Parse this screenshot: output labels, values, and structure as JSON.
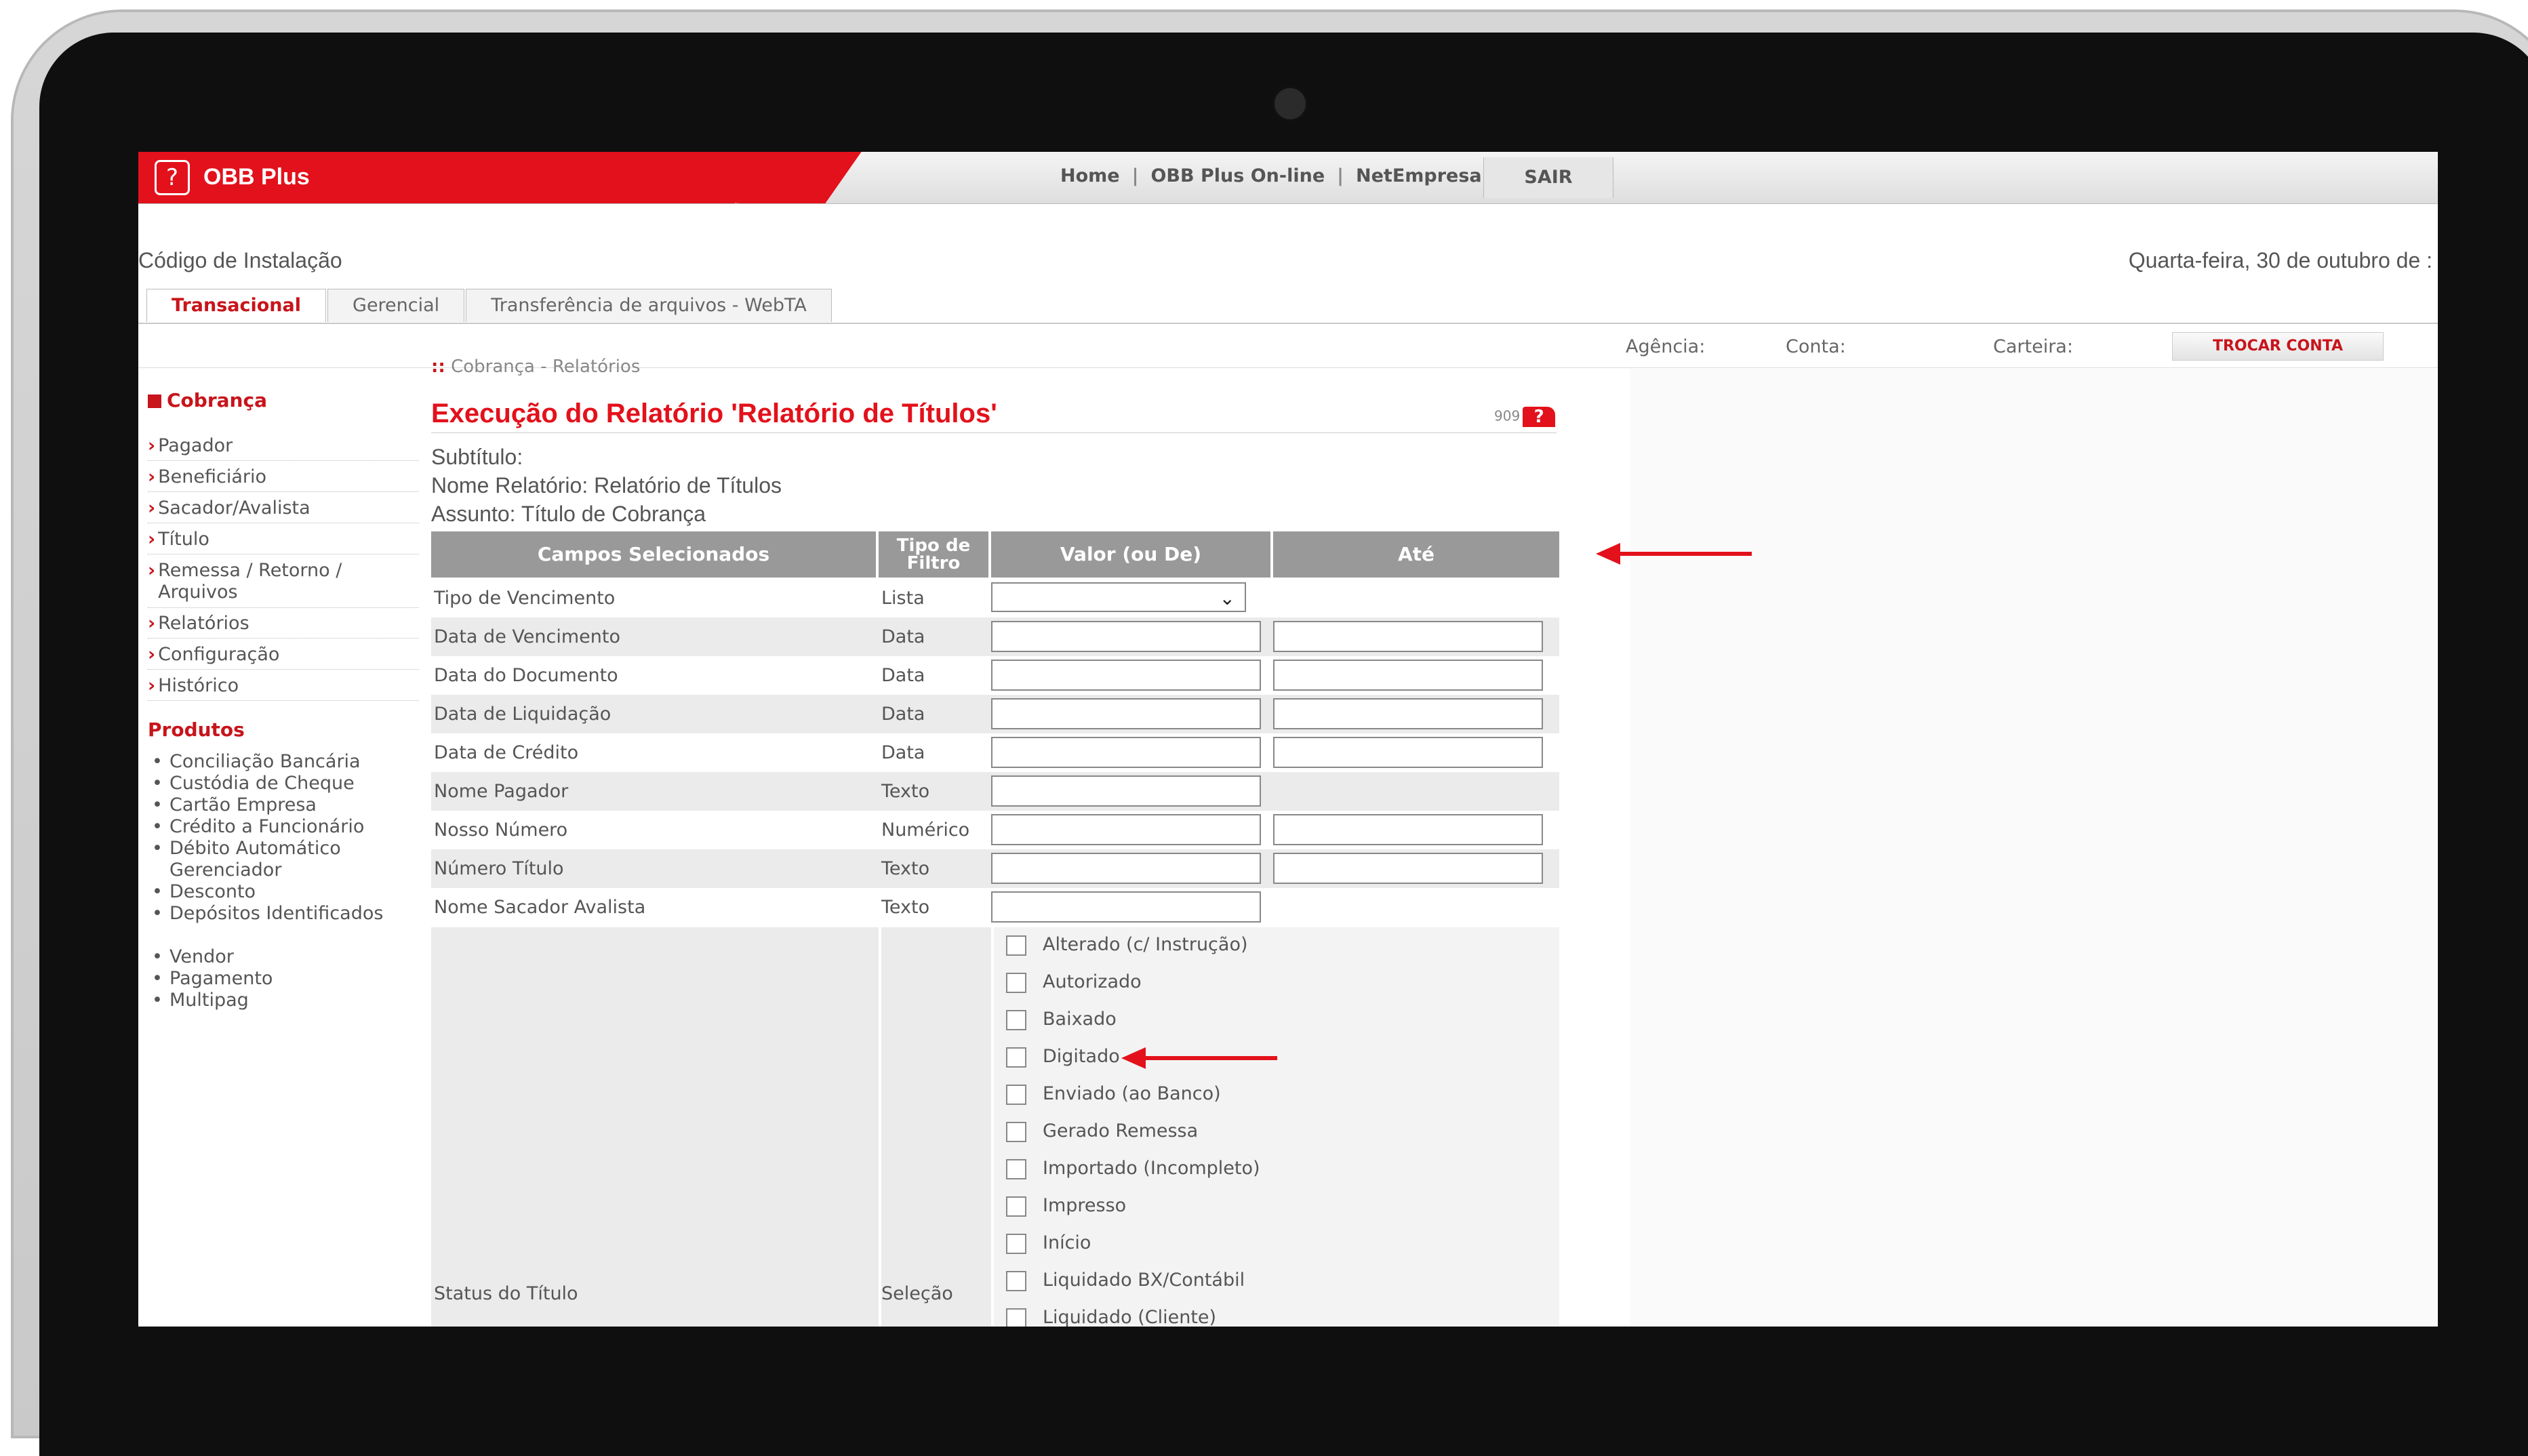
{
  "header": {
    "brand": "OBB Plus",
    "nav": [
      "Home",
      "OBB Plus On-line",
      "NetEmpresa"
    ],
    "logout": "SAIR",
    "install_code_label": "Código de Instalação",
    "date": "Quarta-feira, 30 de outubro de :"
  },
  "tabs": [
    "Transacional",
    "Gerencial",
    "Transferência de arquivos - WebTA"
  ],
  "account": {
    "agencia_label": "Agência:",
    "conta_label": "Conta:",
    "carteira_label": "Carteira:",
    "change_button": "TROCAR CONTA"
  },
  "sidebar": {
    "section_title": "Cobrança",
    "items": [
      "Pagador",
      "Beneficiário",
      "Sacador/Avalista",
      "Título",
      "Remessa / Retorno / Arquivos",
      "Relatórios",
      "Configuração",
      "Histórico"
    ],
    "products_title": "Produtos",
    "products": [
      "Conciliação Bancária",
      "Custódia de Cheque",
      "Cartão Empresa",
      "Crédito a Funcionário",
      "Débito Automático Gerenciador",
      "Desconto",
      "Depósitos Identificados",
      "Vendor",
      "Pagamento",
      "Multipag"
    ]
  },
  "main": {
    "breadcrumb": "Cobrança - Relatórios",
    "title": "Execução do Relatório 'Relatório de Títulos'",
    "help_code": "909",
    "subtitle_label": "Subtítulo:",
    "report_name": "Nome Relatório: Relatório de Títulos",
    "subject": "Assunto: Título de Cobrança"
  },
  "table": {
    "headers": [
      "Campos Selecionados",
      "Tipo de Filtro",
      "Valor (ou De)",
      "Até"
    ],
    "rows": [
      {
        "field": "Tipo de Vencimento",
        "type": "Lista"
      },
      {
        "field": "Data de Vencimento",
        "type": "Data"
      },
      {
        "field": "Data do Documento",
        "type": "Data"
      },
      {
        "field": "Data de Liquidação",
        "type": "Data"
      },
      {
        "field": "Data de Crédito",
        "type": "Data"
      },
      {
        "field": "Nome Pagador",
        "type": "Texto"
      },
      {
        "field": "Nosso Número",
        "type": "Numérico"
      },
      {
        "field": "Número Título",
        "type": "Texto"
      },
      {
        "field": "Nome Sacador Avalista",
        "type": "Texto"
      }
    ],
    "status": {
      "field": "Status do Título",
      "type": "Seleção",
      "options": [
        "Alterado (c/ Instrução)",
        "Autorizado",
        "Baixado",
        "Digitado",
        "Enviado (ao Banco)",
        "Gerado Remessa",
        "Importado (Incompleto)",
        "Impresso",
        "Início",
        "Liquidado BX/Contábil",
        "Liquidado (Cliente)"
      ]
    }
  },
  "colors": {
    "brand_red": "#e3111b",
    "header_gray": "#999999"
  }
}
